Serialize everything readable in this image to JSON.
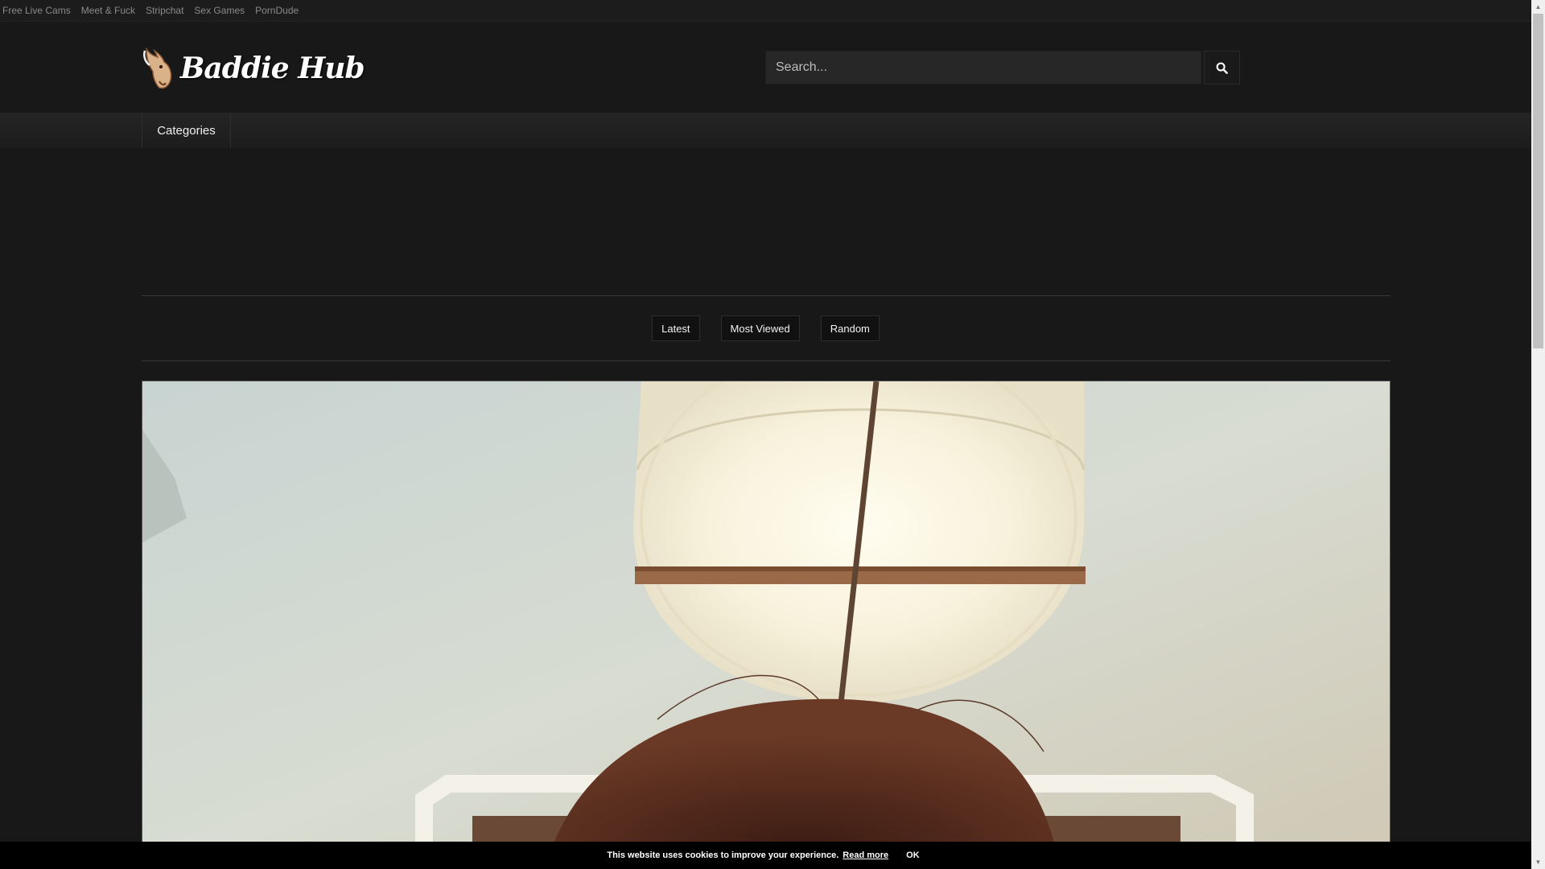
{
  "topbar": {
    "links": [
      "Free Live Cams",
      "Meet & Fuck",
      "Stripchat",
      "Sex Games",
      "PornDude"
    ]
  },
  "header": {
    "logo_text": "Baddie Hub",
    "search_placeholder": "Search...",
    "search_icon": "search-icon"
  },
  "nav": {
    "categories_label": "Categories"
  },
  "filters": {
    "latest": "Latest",
    "most_viewed": "Most Viewed",
    "random": "Random"
  },
  "cookie": {
    "message": "This website uses cookies to improve your experience.",
    "read_more": "Read more",
    "ok": "OK"
  },
  "colors": {
    "background": "#181818",
    "topbar": "#1c1c1c",
    "accent": "#ffffff"
  }
}
